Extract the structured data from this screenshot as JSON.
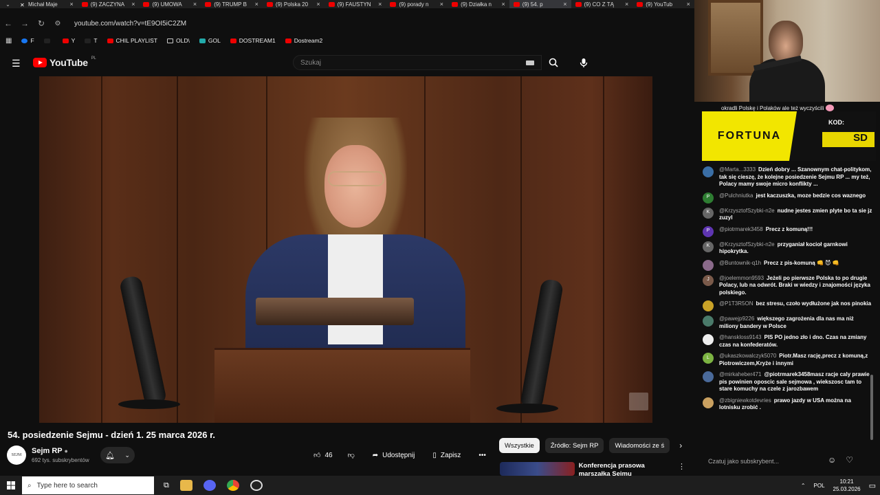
{
  "tabs": [
    {
      "title": "Michał Maje",
      "icon": "x"
    },
    {
      "title": "(9) ZACZYNA",
      "icon": "yt"
    },
    {
      "title": "(9) UMOWA",
      "icon": "yt"
    },
    {
      "title": "(9) TRUMP B",
      "icon": "yt"
    },
    {
      "title": "(9) Polska 20",
      "icon": "yt"
    },
    {
      "title": "(9) FAUSTYN",
      "icon": "yt"
    },
    {
      "title": "(9) porady n",
      "icon": "yt"
    },
    {
      "title": "(9) Działka n",
      "icon": "yt"
    },
    {
      "title": "(9) 54. p",
      "icon": "yt",
      "active": true
    },
    {
      "title": "(9) CO Z TĄ",
      "icon": "yt"
    },
    {
      "title": "(9) YouTub",
      "icon": "yt"
    }
  ],
  "address": {
    "url": "youtube.com/watch?v=tE9OI5iC2ZM"
  },
  "bookmarks": [
    {
      "label": "F",
      "type": "fb"
    },
    {
      "label": "",
      "type": "tw"
    },
    {
      "label": "Y",
      "type": "yt"
    },
    {
      "label": "T",
      "type": "tw"
    },
    {
      "label": "CHIL PLAYLIST",
      "type": "yt"
    },
    {
      "label": "OLD\\",
      "type": "folder"
    },
    {
      "label": "GOL",
      "type": "gol"
    },
    {
      "label": "DOSTREAM1",
      "type": "yt"
    },
    {
      "label": "Dostream2",
      "type": "yt"
    }
  ],
  "header": {
    "logo": "YouTube",
    "region": "PL",
    "search_placeholder": "Szukaj"
  },
  "video": {
    "title": "54. posiedzenie Sejmu - dzień 1. 25 marca 2026 r.",
    "channel": "Sejm RP",
    "subscribers": "692 tys. subskrybentów",
    "avatar_text": "SEJM",
    "likes": "46",
    "share_label": "Udostępnij",
    "save_label": "Zapisz"
  },
  "chips": [
    "Wszystkie",
    "Źródło: Sejm RP",
    "Wiadomości ze ś"
  ],
  "recommendation": {
    "title": "Konferencja prasowa marszałka Sejmu Włodzimierza"
  },
  "chat": {
    "pinned": "okradli Polskę i Polaków ale też wyczyścili",
    "ad": {
      "brand": "FORTUNA",
      "code_label": "KOD:",
      "code": "SD"
    },
    "messages": [
      {
        "author": "@Marta...3333",
        "text": "Dzień dobry ... Szanownym chat-politykom, tak się cieszę, że kolejne posiedzenie Sejmu RP ... my też, Polacy mamy swoje micro konflikty ...",
        "initial": "",
        "color": "#3a6ea5"
      },
      {
        "author": "@Pulchniutka",
        "text": "jest kaczuszka, moze bedzie cos waznego",
        "initial": "P",
        "color": "#2e7d32"
      },
      {
        "author": "@KrzysztofSzybki-n2e",
        "text": "nudne jestes zmien plyte bo ta sie jz zuzyl",
        "initial": "K",
        "color": "#666"
      },
      {
        "author": "@piotrmarek3458",
        "text": "Precz z komuną!!!",
        "initial": "P",
        "color": "#5e35b1"
      },
      {
        "author": "@KrzysztofSzybki-n2e",
        "text": "przyganiał kocioł garnkowi hipokrytka.",
        "initial": "K",
        "color": "#666"
      },
      {
        "author": "@Buntownik-q1h",
        "text": "Precz z pis-komuną 👊 😈 👊",
        "initial": "",
        "color": "#8a6a8a"
      },
      {
        "author": "@joelemmon9593",
        "text": "Jeżeli po pierwsze Polska to po drugie Polacy, lub na odwrót. Braki w wiedzy i znajomości języka polskiego.",
        "initial": "J",
        "color": "#7a5a4a"
      },
      {
        "author": "@P1T3R5ON",
        "text": "bez stresu, czoło wydłużone jak nos pinokia",
        "initial": "",
        "color": "#c9a227"
      },
      {
        "author": "@pawejp9226",
        "text": "większego zagrożenia dla nas ma niż miliony bandery w Polsce",
        "initial": "",
        "color": "#4a7a6a"
      },
      {
        "author": "@hanskloss9143",
        "text": "PIS PO jedno zło i dno. Czas na zmiany czas na konfederatów.",
        "initial": "",
        "color": "#eee"
      },
      {
        "author": "@ukaszkowalczyk5070",
        "text": "Piotr.Masz rację,precz z komuną,z Piotrowiczem,Kryże i innymi",
        "initial": "L",
        "color": "#7cb342"
      },
      {
        "author": "@mirkaheber471",
        "text": "@piotrmarek3458masz racje caly prawie pis powinien oposcic sale sejmowa , wiekszosc tam to stare komuchy na czele z jarozbawem",
        "initial": "",
        "color": "#4a6a9a"
      },
      {
        "author": "@zbigniewkotdevries",
        "text": "prawo jazdy w USA można na lotnisku zrobić .",
        "initial": "",
        "color": "#c9a060"
      }
    ],
    "input_placeholder": "Czatuj jako subskrybent..."
  },
  "taskbar": {
    "search_placeholder": "Type here to search",
    "lang": "POL",
    "time": "10:21",
    "date": "25.03.2026"
  }
}
